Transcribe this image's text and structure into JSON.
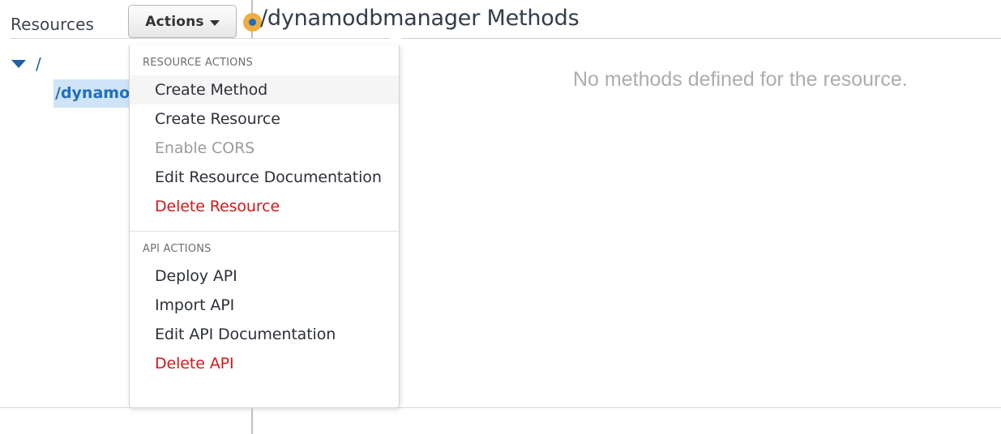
{
  "header": {
    "resources_label": "Resources",
    "actions_button_label": "Actions",
    "caret_icon": "chevron-down-icon",
    "resource_dot_icon": "resource-node-dot-icon",
    "page_title": "/dynamodbmanager Methods",
    "dot_outer_color": "#f0ad3e",
    "dot_inner_color": "#1c6fbd"
  },
  "tree": {
    "root": {
      "caret_icon": "triangle-down-icon",
      "label": "/"
    },
    "child": {
      "label": "/dynamodbmanager",
      "selected": true,
      "highlight_color": "#cfe4f7",
      "text_color": "#1f6fc0"
    }
  },
  "main": {
    "empty_message": "No methods defined for the resource."
  },
  "dropdown": {
    "sections": [
      {
        "header": "RESOURCE ACTIONS",
        "items": [
          {
            "label": "Create Method",
            "state": "highlighted"
          },
          {
            "label": "Create Resource",
            "state": "normal"
          },
          {
            "label": "Enable CORS",
            "state": "disabled"
          },
          {
            "label": "Edit Resource Documentation",
            "state": "normal"
          },
          {
            "label": "Delete Resource",
            "state": "danger"
          }
        ]
      },
      {
        "header": "API ACTIONS",
        "items": [
          {
            "label": "Deploy API",
            "state": "normal"
          },
          {
            "label": "Import API",
            "state": "normal"
          },
          {
            "label": "Edit API Documentation",
            "state": "normal"
          },
          {
            "label": "Delete API",
            "state": "danger"
          }
        ]
      }
    ],
    "danger_color": "#d0181b",
    "disabled_color": "#9b9b9b"
  }
}
